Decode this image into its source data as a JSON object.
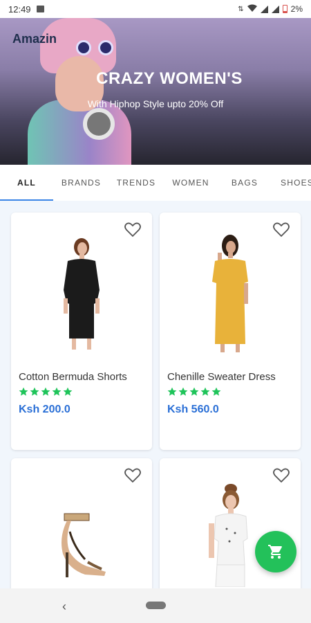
{
  "status_bar": {
    "time": "12:49",
    "battery": "2%"
  },
  "hero": {
    "brand": "Amazin",
    "title": "CRAZY WOMEN'S",
    "subtitle": "With Hiphop Style upto 20% Off"
  },
  "tabs": [
    {
      "label": "ALL",
      "active": true
    },
    {
      "label": "BRANDS",
      "active": false
    },
    {
      "label": "TRENDS",
      "active": false
    },
    {
      "label": "WOMEN",
      "active": false
    },
    {
      "label": "BAGS",
      "active": false
    },
    {
      "label": "SHOES",
      "active": false
    }
  ],
  "products": [
    {
      "name": "Cotton Bermuda Shorts",
      "price": "Ksh 200.0",
      "rating": 5
    },
    {
      "name": "Chenille Sweater Dress",
      "price": "Ksh 560.0",
      "rating": 5
    },
    {
      "name": "",
      "price": "",
      "rating": 0
    },
    {
      "name": "",
      "price": "",
      "rating": 0
    }
  ],
  "icons": {
    "favorite": "heart-outline-icon",
    "cart": "shopping-cart-icon",
    "back": "back-chevron-icon"
  },
  "colors": {
    "accent": "#3a84e6",
    "price": "#2a6fd6",
    "stars": "#1fc45a",
    "fab": "#23c15a"
  }
}
